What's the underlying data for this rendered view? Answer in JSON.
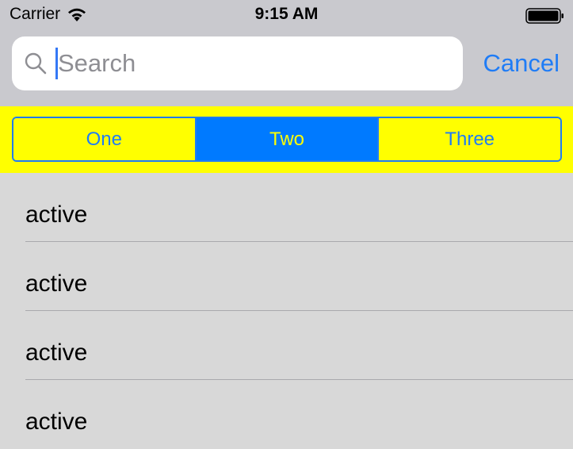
{
  "status_bar": {
    "carrier": "Carrier",
    "time": "9:15 AM",
    "wifi_icon": "wifi-icon",
    "battery_icon": "battery-icon"
  },
  "search": {
    "placeholder": "Search",
    "value": "",
    "icon": "search-icon",
    "cancel_label": "Cancel"
  },
  "scope_bar": {
    "background_color": "#ffff00",
    "accent_color": "#007aff",
    "segments": [
      {
        "label": "One",
        "selected": false
      },
      {
        "label": "Two",
        "selected": true
      },
      {
        "label": "Three",
        "selected": false
      }
    ]
  },
  "list": {
    "items": [
      {
        "label": "active"
      },
      {
        "label": "active"
      },
      {
        "label": "active"
      },
      {
        "label": "active"
      }
    ]
  }
}
